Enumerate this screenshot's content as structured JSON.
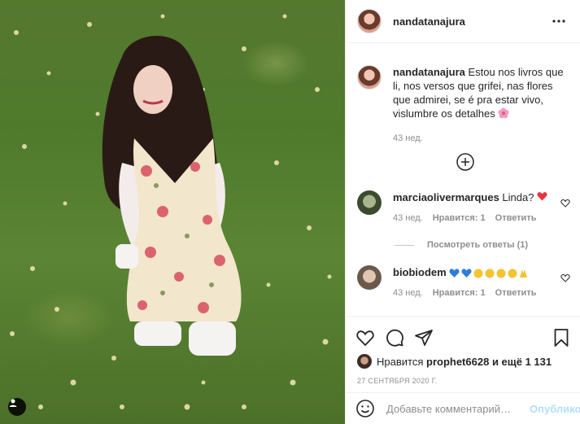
{
  "post": {
    "username": "nandatanajura",
    "caption": "Estou nos livros que li, nos versos que grifei, nas flores que admirei, se é pra estar vivo, vislumbre os detalhes",
    "caption_age": "43 нед."
  },
  "comments": [
    {
      "username": "marciaolivermarques",
      "text": "Linda?",
      "age": "43 нед.",
      "likes": "Нравится: 1",
      "reply": "Ответить",
      "view_replies": "Посмотреть ответы (1)"
    },
    {
      "username": "biobiodem",
      "text": "",
      "age": "43 нед.",
      "likes": "Нравится: 1",
      "reply": "Ответить"
    }
  ],
  "likes_line": {
    "prefix": "Нравится",
    "user": "prophet6628",
    "suffix": "и ещё 1 131"
  },
  "date": "27 сентября 2020 г.",
  "add_comment": {
    "placeholder": "Добавьте комментарий…",
    "post_label": "Опубликовать"
  },
  "icons": {
    "like": "heart-icon",
    "comment": "comment-icon",
    "share": "share-icon",
    "save": "bookmark-icon",
    "more": "more-icon",
    "emoji": "emoji-icon",
    "load_more": "plus-circle-icon"
  },
  "colors": {
    "accent_blue": "#b2dffc",
    "muted": "#8e8e8e",
    "text": "#262626"
  }
}
